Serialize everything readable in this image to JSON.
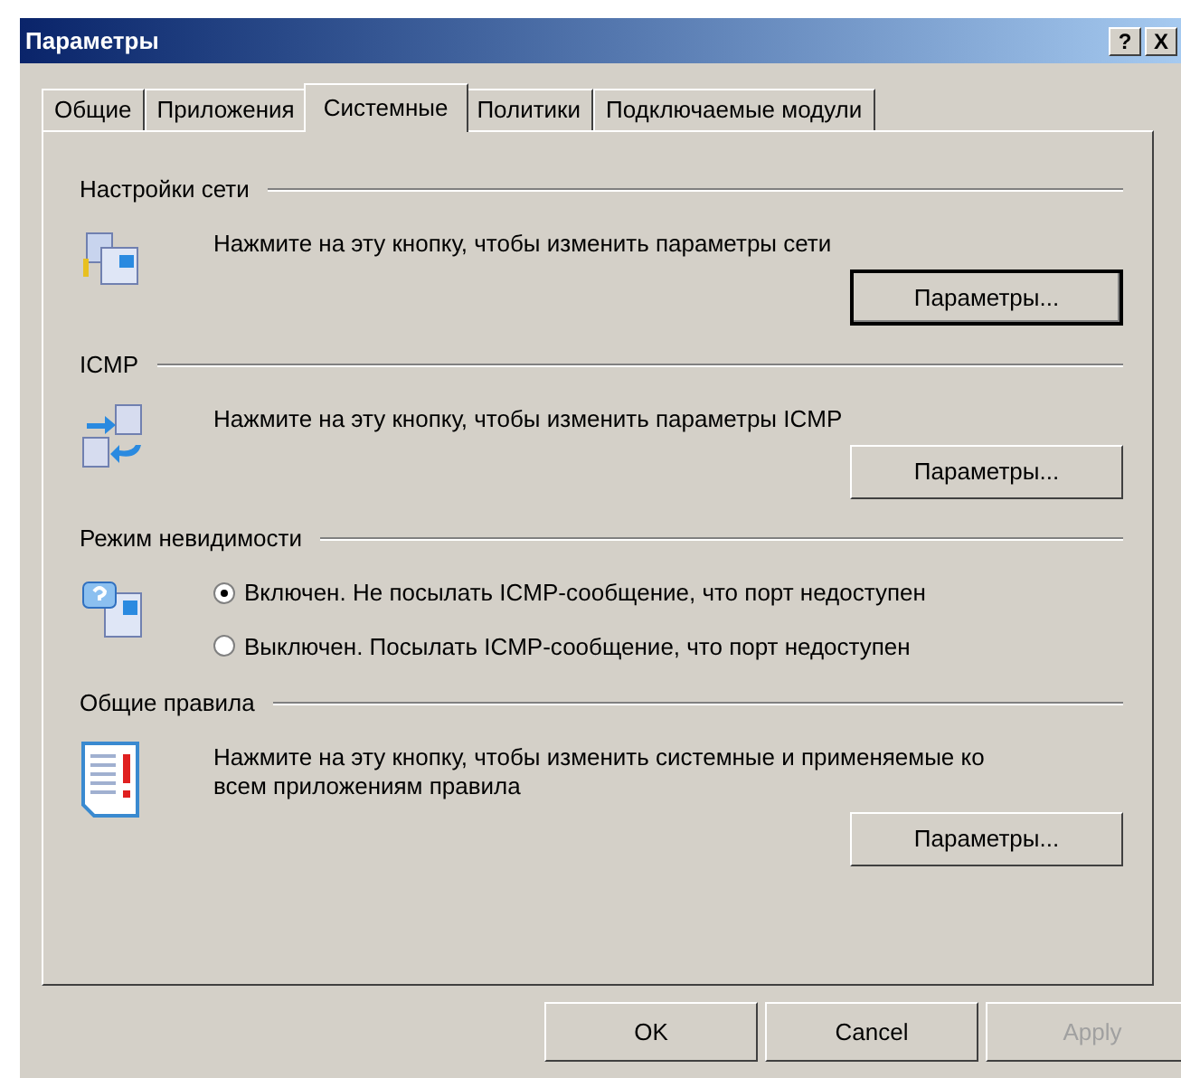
{
  "window": {
    "title": "Параметры",
    "help_button": "?",
    "close_button": "X"
  },
  "tabs": [
    {
      "label": "Общие",
      "selected": false
    },
    {
      "label": "Приложения",
      "selected": false
    },
    {
      "label": "Системные",
      "selected": true
    },
    {
      "label": "Политики",
      "selected": false
    },
    {
      "label": "Подключаемые модули",
      "selected": false
    }
  ],
  "sections": [
    {
      "kind": "button",
      "heading": "Настройки сети",
      "text": "Нажмите на эту кнопку, чтобы изменить параметры сети",
      "button": "Параметры...",
      "default": true
    },
    {
      "kind": "button",
      "heading": "ICMP",
      "text": "Нажмите на эту кнопку, чтобы изменить параметры ICMP",
      "button": "Параметры...",
      "default": false
    },
    {
      "kind": "radio",
      "heading": "Режим невидимости",
      "options": [
        {
          "label": "Включен. Не посылать ICMP-сообщение, что порт недоступен",
          "selected": true
        },
        {
          "label": "Выключен. Посылать ICMP-сообщение, что порт недоступен",
          "selected": false
        }
      ]
    },
    {
      "kind": "button",
      "heading": "Общие правила",
      "text": "Нажмите на эту кнопку, чтобы изменить системные и применяемые ко всем приложениям правила",
      "button": "Параметры...",
      "default": false
    }
  ],
  "buttons": [
    {
      "label": "OK",
      "disabled": false
    },
    {
      "label": "Cancel",
      "disabled": false
    },
    {
      "label": "Apply",
      "disabled": true
    }
  ]
}
